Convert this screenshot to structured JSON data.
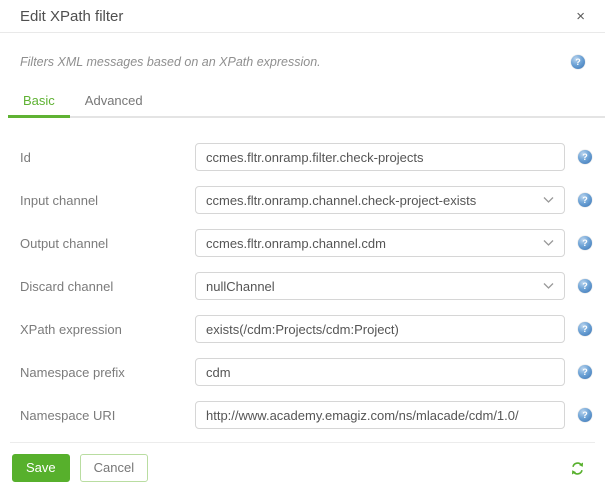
{
  "dialog": {
    "title": "Edit XPath filter",
    "close_glyph": "×",
    "description": "Filters XML messages based on an XPath expression.",
    "tabs": [
      {
        "label": "Basic",
        "active": true
      },
      {
        "label": "Advanced",
        "active": false
      }
    ],
    "fields": [
      {
        "label": "Id",
        "type": "text",
        "value": "ccmes.fltr.onramp.filter.check-projects"
      },
      {
        "label": "Input channel",
        "type": "select",
        "value": "ccmes.fltr.onramp.channel.check-project-exists"
      },
      {
        "label": "Output channel",
        "type": "select",
        "value": "ccmes.fltr.onramp.channel.cdm"
      },
      {
        "label": "Discard channel",
        "type": "select",
        "value": "nullChannel"
      },
      {
        "label": "XPath expression",
        "type": "text",
        "value": "exists(/cdm:Projects/cdm:Project)"
      },
      {
        "label": "Namespace prefix",
        "type": "text",
        "value": "cdm"
      },
      {
        "label": "Namespace URI",
        "type": "text",
        "value": "http://www.academy.emagiz.com/ns/mlacade/cdm/1.0/"
      }
    ],
    "help_glyph": "?",
    "footer": {
      "save_label": "Save",
      "cancel_label": "Cancel"
    },
    "colors": {
      "accent_green": "#5fb233",
      "help_blue": "#3a74b4",
      "border_gray": "#d6d6d6"
    }
  }
}
